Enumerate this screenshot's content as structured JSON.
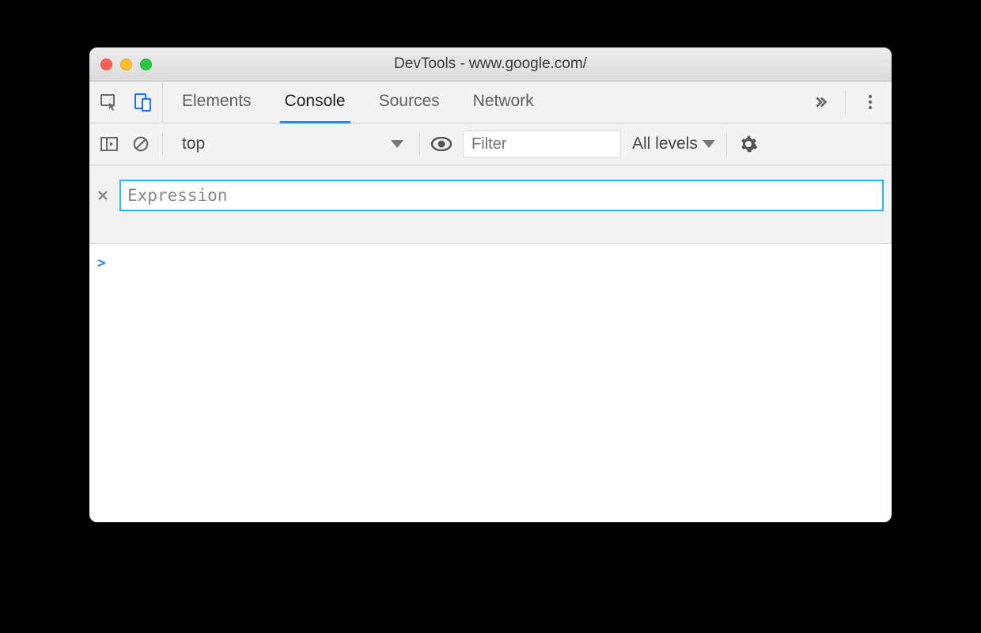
{
  "window": {
    "title": "DevTools - www.google.com/"
  },
  "tabs": {
    "items": [
      "Elements",
      "Console",
      "Sources",
      "Network"
    ],
    "active": "Console"
  },
  "toolbar": {
    "context": "top",
    "filter_placeholder": "Filter",
    "levels_label": "All levels"
  },
  "live_expression": {
    "placeholder": "Expression",
    "value": ""
  },
  "console": {
    "prompt": ">"
  }
}
